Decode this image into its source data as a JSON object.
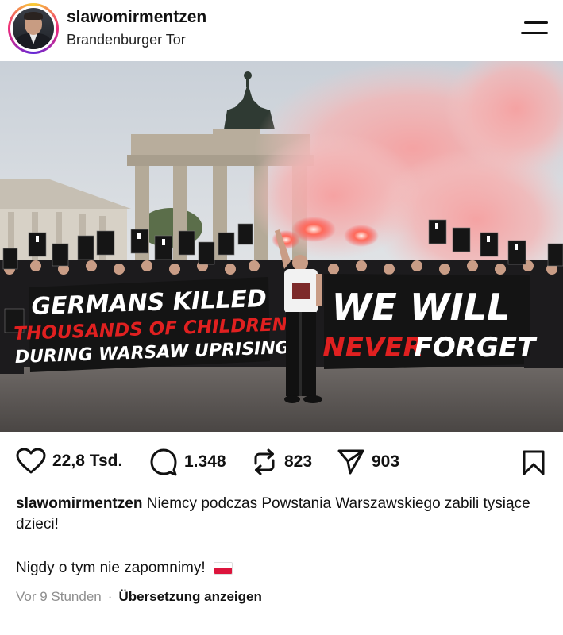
{
  "post": {
    "username": "slawomirmentzen",
    "location": "Brandenburger Tor",
    "menu_icon": "menu-icon"
  },
  "photo": {
    "banner_left": {
      "line1": "GERMANS KILLED",
      "line2": "THOUSANDS OF CHILDREN",
      "line3": "DURING WARSAW UPRISING"
    },
    "banner_right": {
      "line1": "WE WILL",
      "line2_red": "NEVER",
      "line2_white": "FORGET"
    }
  },
  "actions": {
    "likes": "22,8 Tsd.",
    "comments": "1.348",
    "reposts": "823",
    "shares": "903",
    "icons": [
      "heart-icon",
      "comment-icon",
      "repost-icon",
      "share-icon",
      "bookmark-icon"
    ]
  },
  "caption": {
    "username": "slawomirmentzen",
    "text": "Niemcy podczas Powstania Warszawskiego zabili tysiące dzieci!",
    "line2": "Nigdy o tym nie zapomnimy!",
    "time": "Vor 9 Stunden",
    "separator": "·",
    "translate": "Übersetzung anzeigen"
  },
  "colors": {
    "accent_red": "#e02020",
    "banner_black": "#141414",
    "smoke": "#f28c8c",
    "meta_gray": "#8e8e8e"
  }
}
